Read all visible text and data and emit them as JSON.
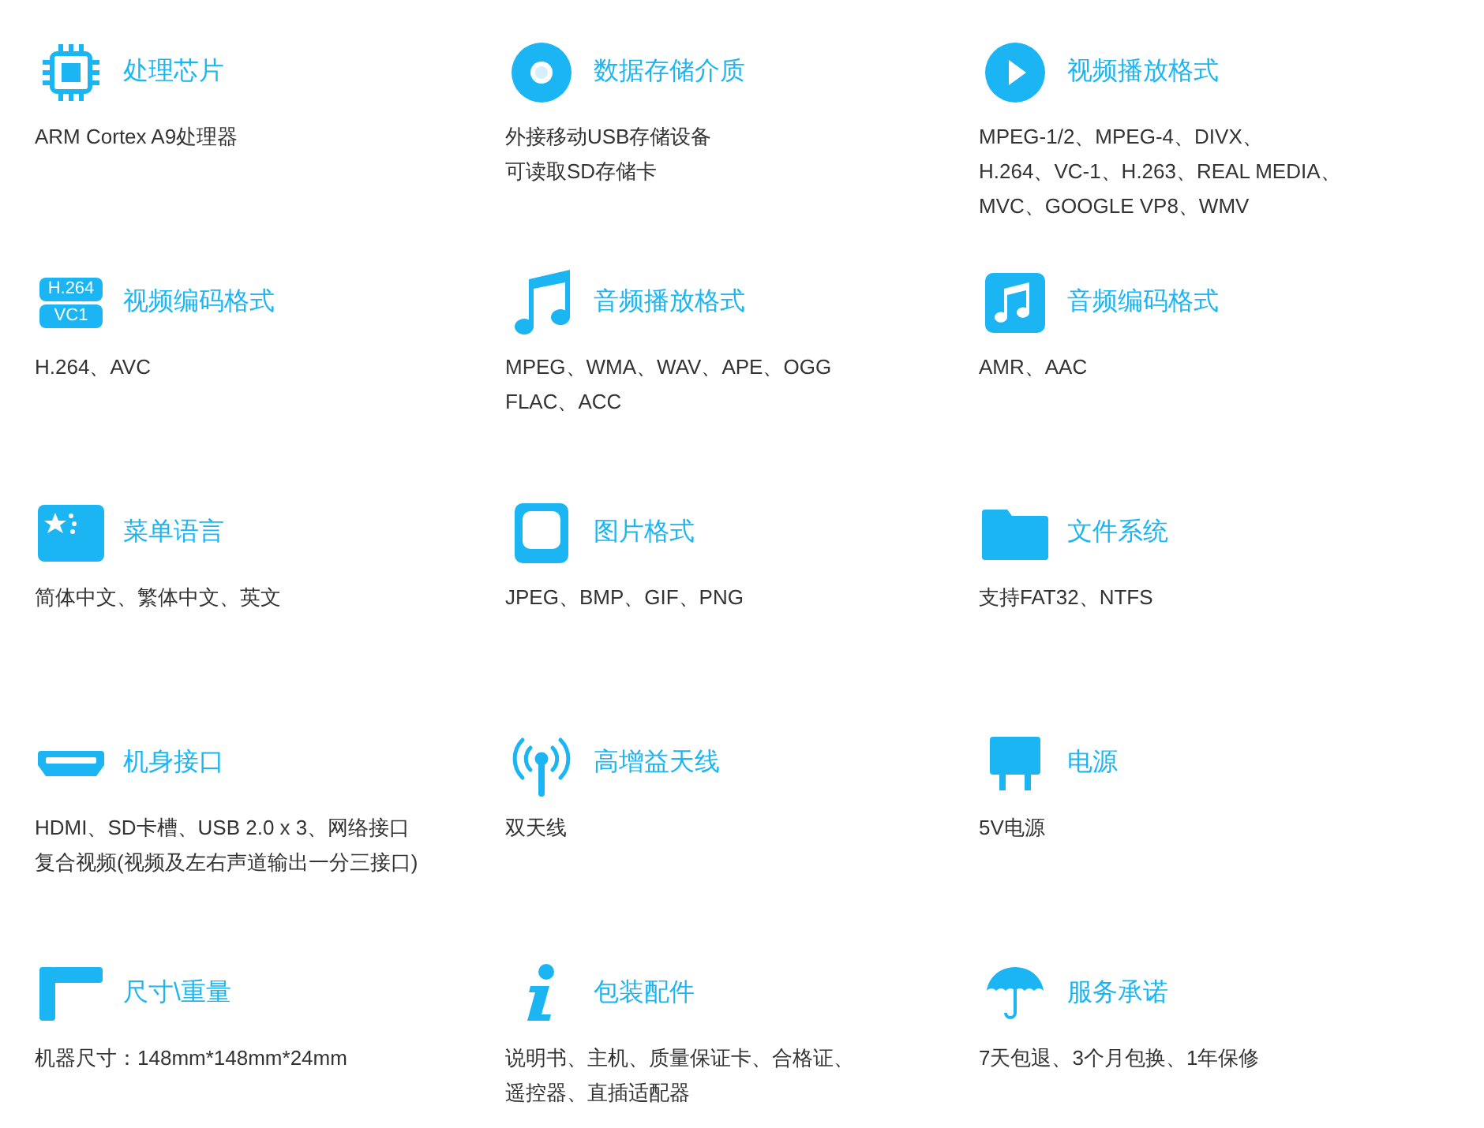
{
  "features": [
    {
      "kind": "chip",
      "title": "处理芯片",
      "lines": [
        "ARM Cortex A9处理器"
      ]
    },
    {
      "kind": "disc",
      "title": "数据存储介质",
      "lines": [
        "外接移动USB存储设备",
        "可读取SD存储卡"
      ]
    },
    {
      "kind": "play",
      "title": "视频播放格式",
      "lines": [
        "MPEG-1/2、MPEG-4、DIVX、",
        "H.264、VC-1、H.263、REAL MEDIA、",
        "MVC、GOOGLE VP8、WMV"
      ]
    },
    {
      "kind": "codec",
      "icon_labels": [
        "H.264",
        "VC1"
      ],
      "title": "视频编码格式",
      "lines": [
        "H.264、AVC"
      ]
    },
    {
      "kind": "note",
      "title": "音频播放格式",
      "lines": [
        "MPEG、WMA、WAV、APE、OGG",
        "FLAC、ACC"
      ]
    },
    {
      "kind": "note-square",
      "title": "音频编码格式",
      "lines": [
        "AMR、AAC"
      ]
    },
    {
      "kind": "flag",
      "title": "菜单语言",
      "lines": [
        "简体中文、繁体中文、英文"
      ]
    },
    {
      "kind": "image",
      "title": "图片格式",
      "lines": [
        "JPEG、BMP、GIF、PNG"
      ]
    },
    {
      "kind": "folder",
      "title": "文件系统",
      "lines": [
        "支持FAT32、NTFS"
      ]
    },
    {
      "kind": "hdmi",
      "title": "机身接口",
      "lines": [
        "HDMI、SD卡槽、USB 2.0 x 3、网络接口",
        "复合视频(视频及左右声道输出一分三接口)"
      ]
    },
    {
      "kind": "antenna",
      "title": "高增益天线",
      "lines": [
        "双天线"
      ]
    },
    {
      "kind": "plug",
      "title": "电源",
      "lines": [
        "5V电源"
      ]
    },
    {
      "kind": "ruler",
      "title": "尺寸\\重量",
      "lines": [
        "机器尺寸：148mm*148mm*24mm"
      ]
    },
    {
      "kind": "info",
      "title": "包装配件",
      "lines": [
        "说明书、主机、质量保证卡、合格证、",
        "遥控器、直插适配器"
      ]
    },
    {
      "kind": "umbrella",
      "title": "服务承诺",
      "lines": [
        "7天包退、3个月包换、1年保修"
      ]
    }
  ]
}
